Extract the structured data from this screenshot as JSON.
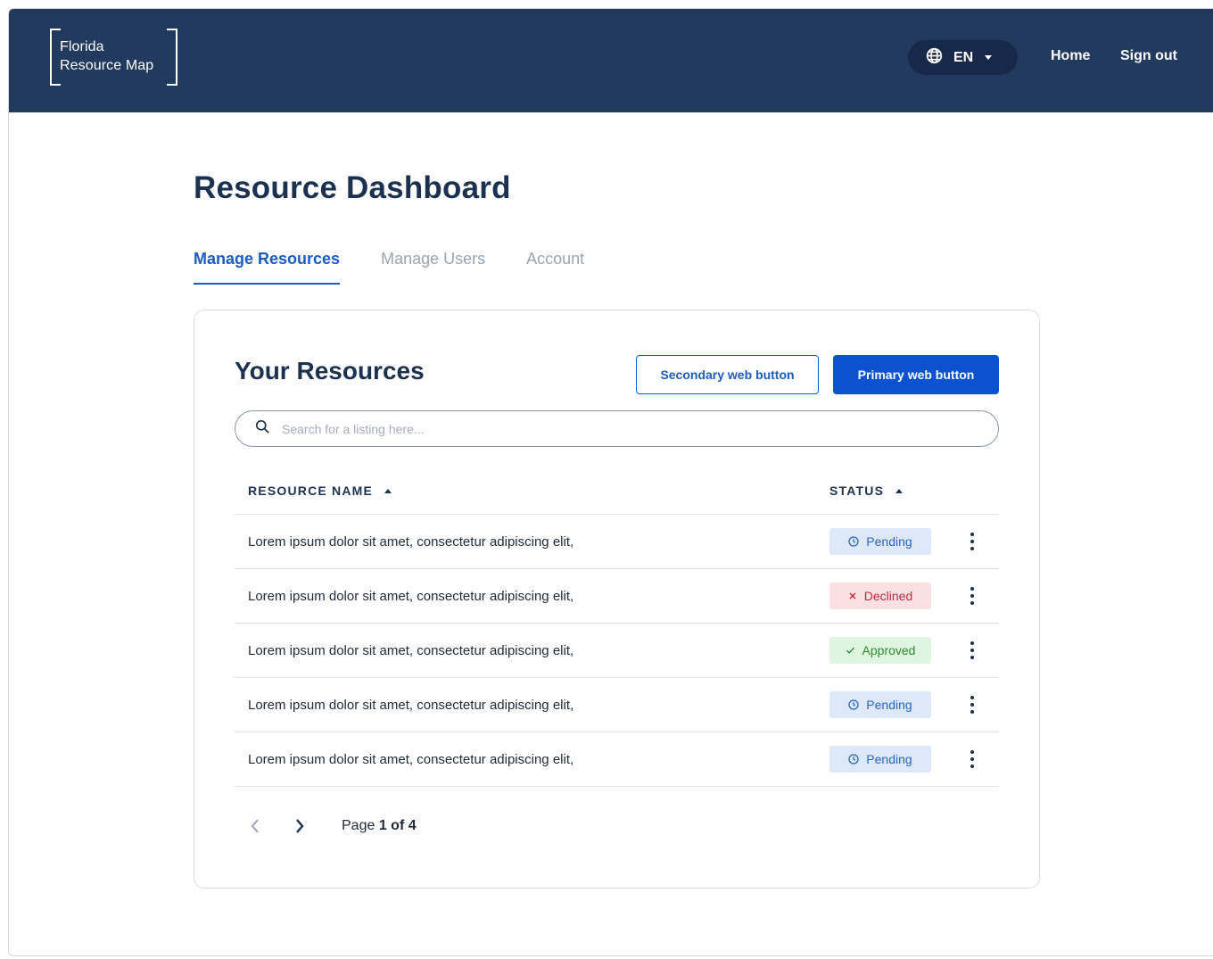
{
  "header": {
    "logo_line1": "Florida",
    "logo_line2": "Resource Map",
    "language": "EN",
    "nav": {
      "home": "Home",
      "sign_out": "Sign out"
    }
  },
  "page": {
    "title": "Resource Dashboard",
    "tabs": [
      {
        "label": "Manage Resources",
        "active": true
      },
      {
        "label": "Manage Users",
        "active": false
      },
      {
        "label": "Account",
        "active": false
      }
    ]
  },
  "card": {
    "title": "Your Resources",
    "secondary_button": "Secondary web button",
    "primary_button": "Primary web button",
    "search": {
      "placeholder": "Search for a listing here...",
      "value": ""
    },
    "columns": {
      "name": "RESOURCE NAME",
      "status": "STATUS"
    },
    "rows": [
      {
        "name": "Lorem ipsum dolor sit amet, consectetur adipiscing elit,",
        "status": "Pending"
      },
      {
        "name": "Lorem ipsum dolor sit amet, consectetur adipiscing elit,",
        "status": "Declined"
      },
      {
        "name": "Lorem ipsum dolor sit amet, consectetur adipiscing elit,",
        "status": "Approved"
      },
      {
        "name": "Lorem ipsum dolor sit amet, consectetur adipiscing elit,",
        "status": "Pending"
      },
      {
        "name": "Lorem ipsum dolor sit amet, consectetur adipiscing elit,",
        "status": "Pending"
      }
    ],
    "pagination": {
      "prefix": "Page",
      "current": "1 of 4"
    }
  },
  "icons": {
    "language": "globe-icon",
    "language_dropdown": "caret-down-icon",
    "search": "search-icon",
    "sort": "sort-up-icon",
    "pending": "clock-icon",
    "declined": "x-icon",
    "approved": "check-icon",
    "row_menu": "kebab-menu-icon",
    "prev": "chevron-left-icon",
    "next": "chevron-right-icon"
  },
  "colors": {
    "header_bg": "#223a5e",
    "language_pill_bg": "#17294a",
    "accent": "#1b5bc4",
    "primary_button": "#0a52d0",
    "pending_bg": "#dde8f9",
    "pending_text": "#2b63c8",
    "declined_bg": "#fbe0e3",
    "declined_text": "#c22a3c",
    "approved_bg": "#dff5df",
    "approved_text": "#2d8a32"
  }
}
